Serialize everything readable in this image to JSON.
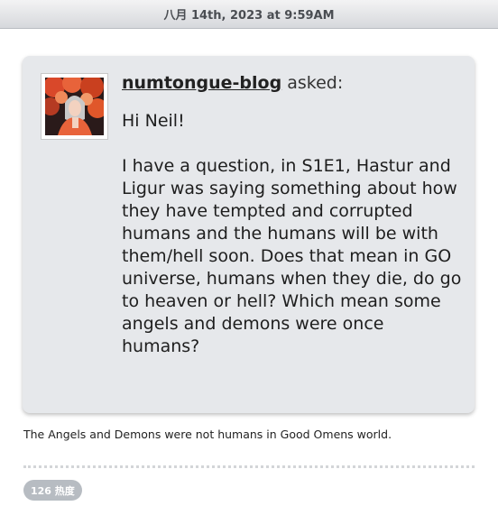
{
  "post": {
    "date": "八月 14th, 2023 at 9:59AM",
    "asker": "numtongue-blog",
    "asked_label": "asked:",
    "question_greeting": "Hi Neil!",
    "question_body": "I have a question, in S1E1, Hastur and Ligur was saying something about how they have tempted and corrupted humans and the humans will be with them/hell soon. Does that mean in GO universe, humans when they die, do go to heaven or hell? Which mean some angels and demons were once humans?",
    "answer": "The Angels and Demons were not humans in Good Omens world.",
    "notes": "126 热度"
  },
  "colors": {
    "ask_background": "#e6e8eb",
    "notes_badge": "#b7bcc2",
    "avatar_accent": "#e0572a"
  },
  "icons": {
    "avatar": "avatar-illustration"
  }
}
